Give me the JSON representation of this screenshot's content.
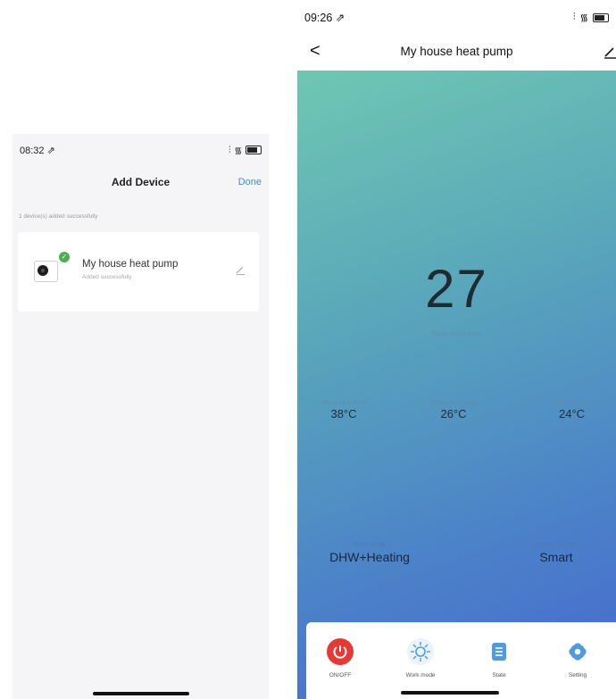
{
  "left_screen": {
    "status_time": "08:32 ⇗",
    "title": "Add Device",
    "done_label": "Done",
    "success_count": "1 device(s) added successfully",
    "device": {
      "name": "My house heat pump",
      "status": "Added successfully"
    }
  },
  "right_screen": {
    "status_time": "09:26 ⇗",
    "back_label": "<",
    "title": "My house heat pump",
    "big_value": "27",
    "big_label": "Water outlet temp",
    "stats": [
      {
        "label": "Water tank temp",
        "value": "38°C"
      },
      {
        "label": "Water inlet temp",
        "value": "26°C"
      },
      {
        "label": "Ambient temp",
        "value": "24°C"
      }
    ],
    "work_mode": {
      "label": "Work mode",
      "value": "DHW+Heating"
    },
    "operating_mode": {
      "label": "Operating mode",
      "value": "Smart"
    },
    "buttons": [
      {
        "label": "ON/OFF",
        "icon": "power-icon",
        "color": "#e53935"
      },
      {
        "label": "Work mode",
        "icon": "sun-icon",
        "color": "#4f9be0"
      },
      {
        "label": "State",
        "icon": "list-icon",
        "color": "#4f9be0"
      },
      {
        "label": "Setting",
        "icon": "gear-icon",
        "color": "#4f9be0"
      }
    ]
  },
  "colors": {
    "accent_blue": "#3b8ed8",
    "badge_green": "#4caf50",
    "power_red": "#e53935",
    "gradient_top": "#6fc7b2",
    "gradient_bottom": "#4668cf"
  }
}
